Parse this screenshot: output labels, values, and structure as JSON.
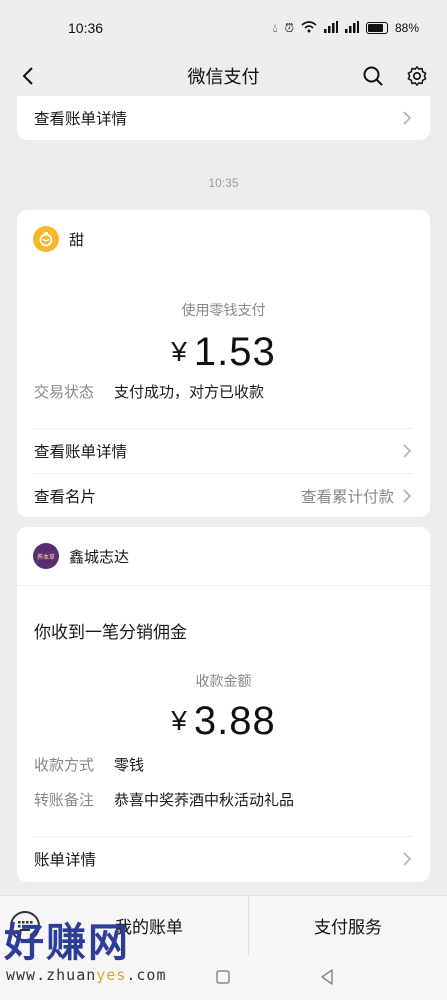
{
  "status_bar": {
    "time": "10:36",
    "battery": "88%"
  },
  "nav": {
    "title": "微信支付"
  },
  "top_card": {
    "link_label": "查看账单详情"
  },
  "timestamp": "10:35",
  "payment_card": {
    "merchant": "甜",
    "method_label": "使用零钱支付",
    "currency": "¥",
    "amount": "1.53",
    "status_key": "交易状态",
    "status_value": "支付成功，对方已收款",
    "bill_detail_label": "查看账单详情",
    "card_label": "查看名片",
    "cumulative_label": "查看累计付款"
  },
  "commission_card": {
    "merchant": "鑫城志达",
    "avatar_text": "荞本草",
    "headline": "你收到一笔分销佣金",
    "amount_label": "收款金额",
    "currency": "¥",
    "amount": "3.88",
    "method_key": "收款方式",
    "method_value": "零钱",
    "note_key": "转账备注",
    "note_value": "恭喜中奖荞酒中秋活动礼品",
    "bill_detail_label": "账单详情"
  },
  "bottom_tabs": {
    "my_bills": "我的账单",
    "pay_services": "支付服务"
  },
  "watermark": {
    "text": "好赚网",
    "url_prefix": "www.zhuan",
    "url_highlight": "yes",
    "url_suffix": ".com"
  }
}
